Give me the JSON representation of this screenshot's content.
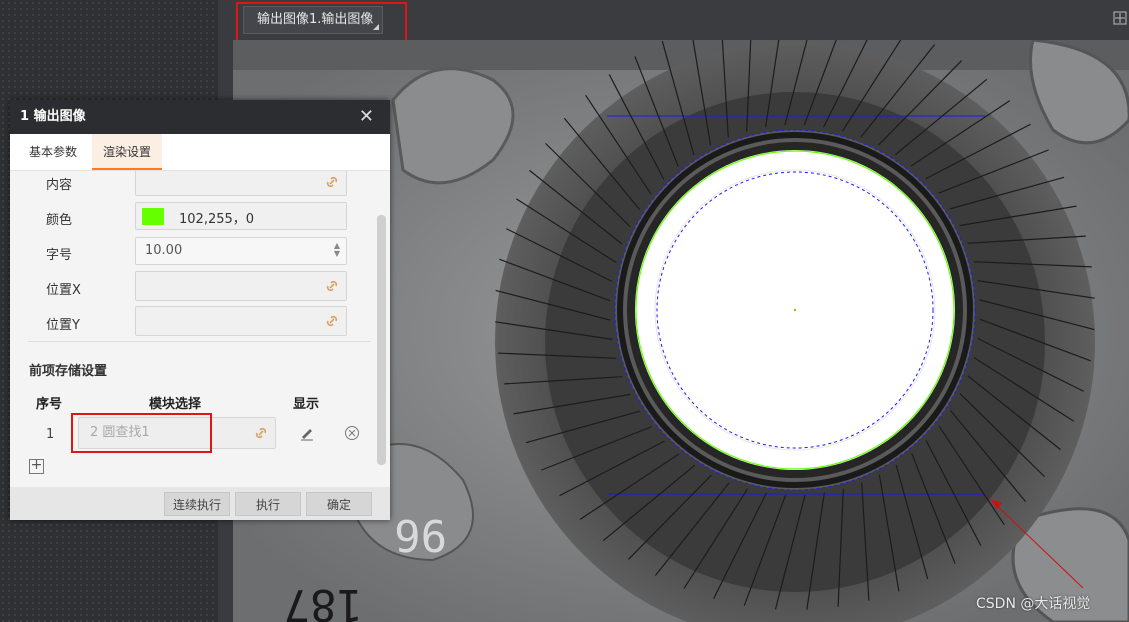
{
  "top_tab": {
    "label": "输出图像1.输出图像"
  },
  "dialog": {
    "title": "1 输出图像",
    "close_glyph": "✕",
    "tabs": [
      {
        "label": "基本参数"
      },
      {
        "label": "渲染设置"
      }
    ],
    "active_tab": "渲染设置",
    "fields": {
      "content": {
        "label": "内容",
        "value": ""
      },
      "color": {
        "label": "颜色",
        "value": "102,255，0",
        "swatch": "#66ff00"
      },
      "font_size": {
        "label": "字号",
        "value": "10.00"
      },
      "pos_x": {
        "label": "位置X",
        "value": ""
      },
      "pos_y": {
        "label": "位置Y",
        "value": ""
      }
    },
    "storage_section": {
      "title": "前项存储设置",
      "columns": [
        "序号",
        "模块选择",
        "显示"
      ],
      "rows": [
        {
          "index": "1",
          "module": "2 圆查找1"
        }
      ]
    },
    "footer_buttons": [
      {
        "label": "连续执行"
      },
      {
        "label": "执行"
      },
      {
        "label": "确定"
      }
    ]
  },
  "watermark": "CSDN @大话视觉",
  "colors": {
    "highlight_red": "#e01515",
    "active_tab_accent": "#ff7a1a",
    "edge_blue": "#1a1aff",
    "fit_green": "#66ff00"
  }
}
